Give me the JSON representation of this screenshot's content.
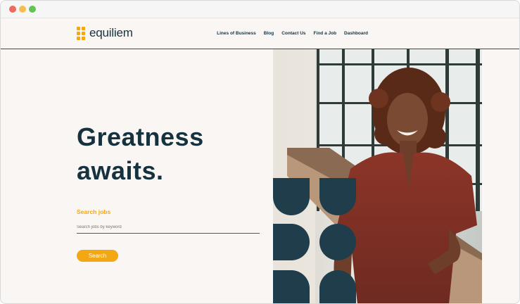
{
  "brand": {
    "name": "equiliem",
    "accent_color": "#f3a712",
    "dark_color": "#17323f"
  },
  "nav": {
    "items": [
      "Lines of Business",
      "Blog",
      "Contact Us",
      "Find a Job",
      "Dashboard"
    ]
  },
  "hero": {
    "headline_line1": "Greatness",
    "headline_line2": "awaits."
  },
  "search": {
    "label": "Search jobs",
    "placeholder": "Search jobs by keyword",
    "button_label": "Search"
  }
}
